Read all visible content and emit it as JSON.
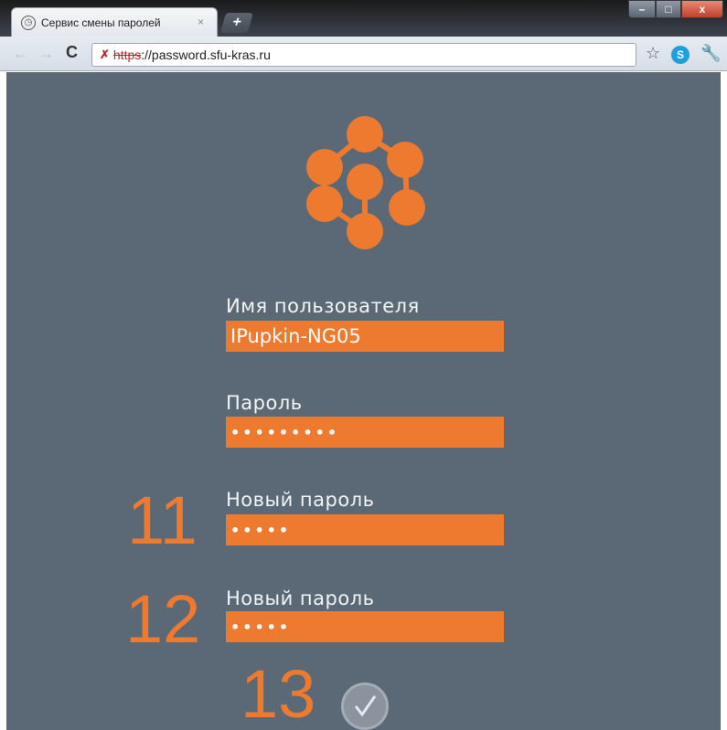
{
  "browser": {
    "tab_title": "Сервис смены паролей",
    "tab_close": "×",
    "new_tab": "+",
    "url_scheme": "https",
    "url_rest": "://password.sfu-kras.ru",
    "window_controls": {
      "minimize": "–",
      "maximize": "□",
      "close": "x"
    }
  },
  "form": {
    "username": {
      "label": "Имя пользователя",
      "value": "IPupkin-NG05"
    },
    "password": {
      "label": "Пароль",
      "value": "•••••••••"
    },
    "new_password": {
      "label": "Новый пароль",
      "value": "•••••"
    },
    "confirm_password": {
      "label": "Новый пароль",
      "value": "•••••"
    }
  },
  "annotations": {
    "step_11": "11",
    "step_12": "12",
    "step_13": "13"
  },
  "colors": {
    "accent": "#ee7a2f",
    "background": "#5b6876",
    "label": "#f2f4f6"
  },
  "icons": [
    "globe-favicon-icon",
    "back-arrow-icon",
    "forward-arrow-icon",
    "reload-icon",
    "broken-lock-icon",
    "star-icon",
    "skype-icon",
    "wrench-icon",
    "checkmark-icon"
  ]
}
